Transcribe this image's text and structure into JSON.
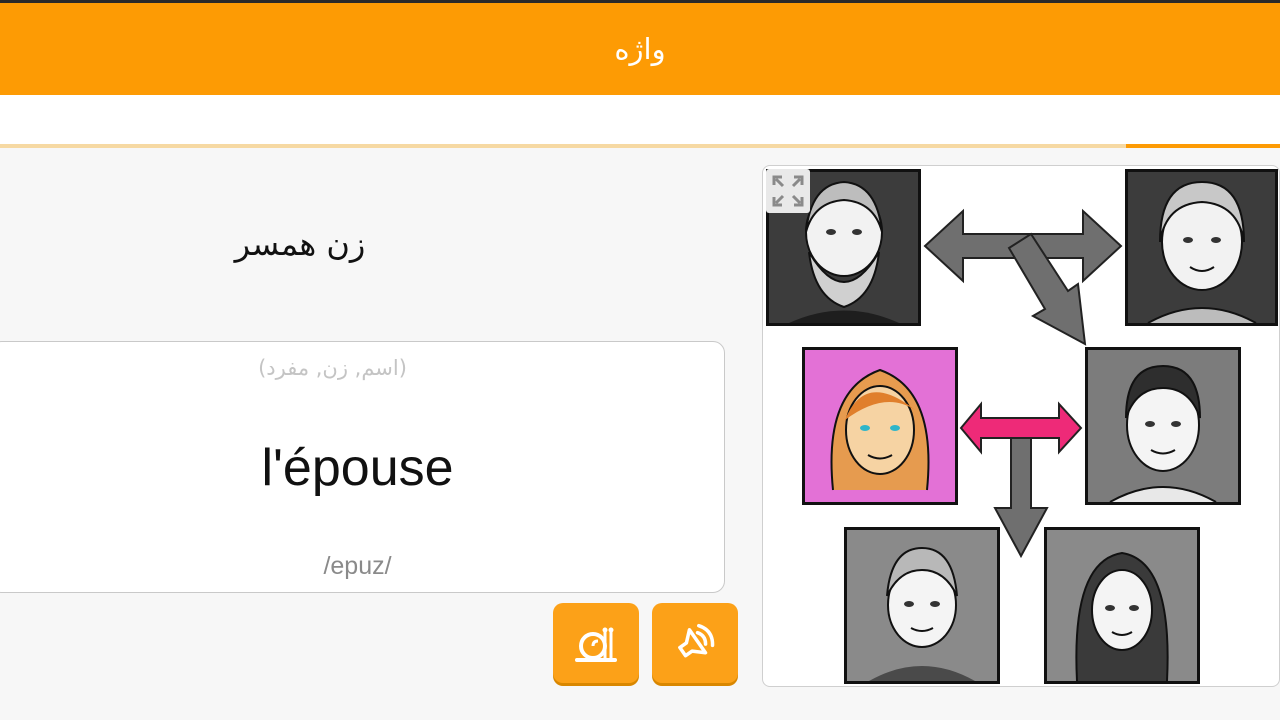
{
  "header": {
    "title": "واژه"
  },
  "progress": {
    "fraction": 0.12
  },
  "card": {
    "translation": "زن همسر",
    "grammar": "(اسم, زن, مفرد)",
    "word": "l'épouse",
    "phonetic": "/epuz/"
  },
  "buttons": [
    {
      "name": "slow-audio",
      "icon": "snail-icon"
    },
    {
      "name": "play-audio",
      "icon": "speaker-icon"
    }
  ],
  "illustration": {
    "description_icon": "expand-icon"
  }
}
